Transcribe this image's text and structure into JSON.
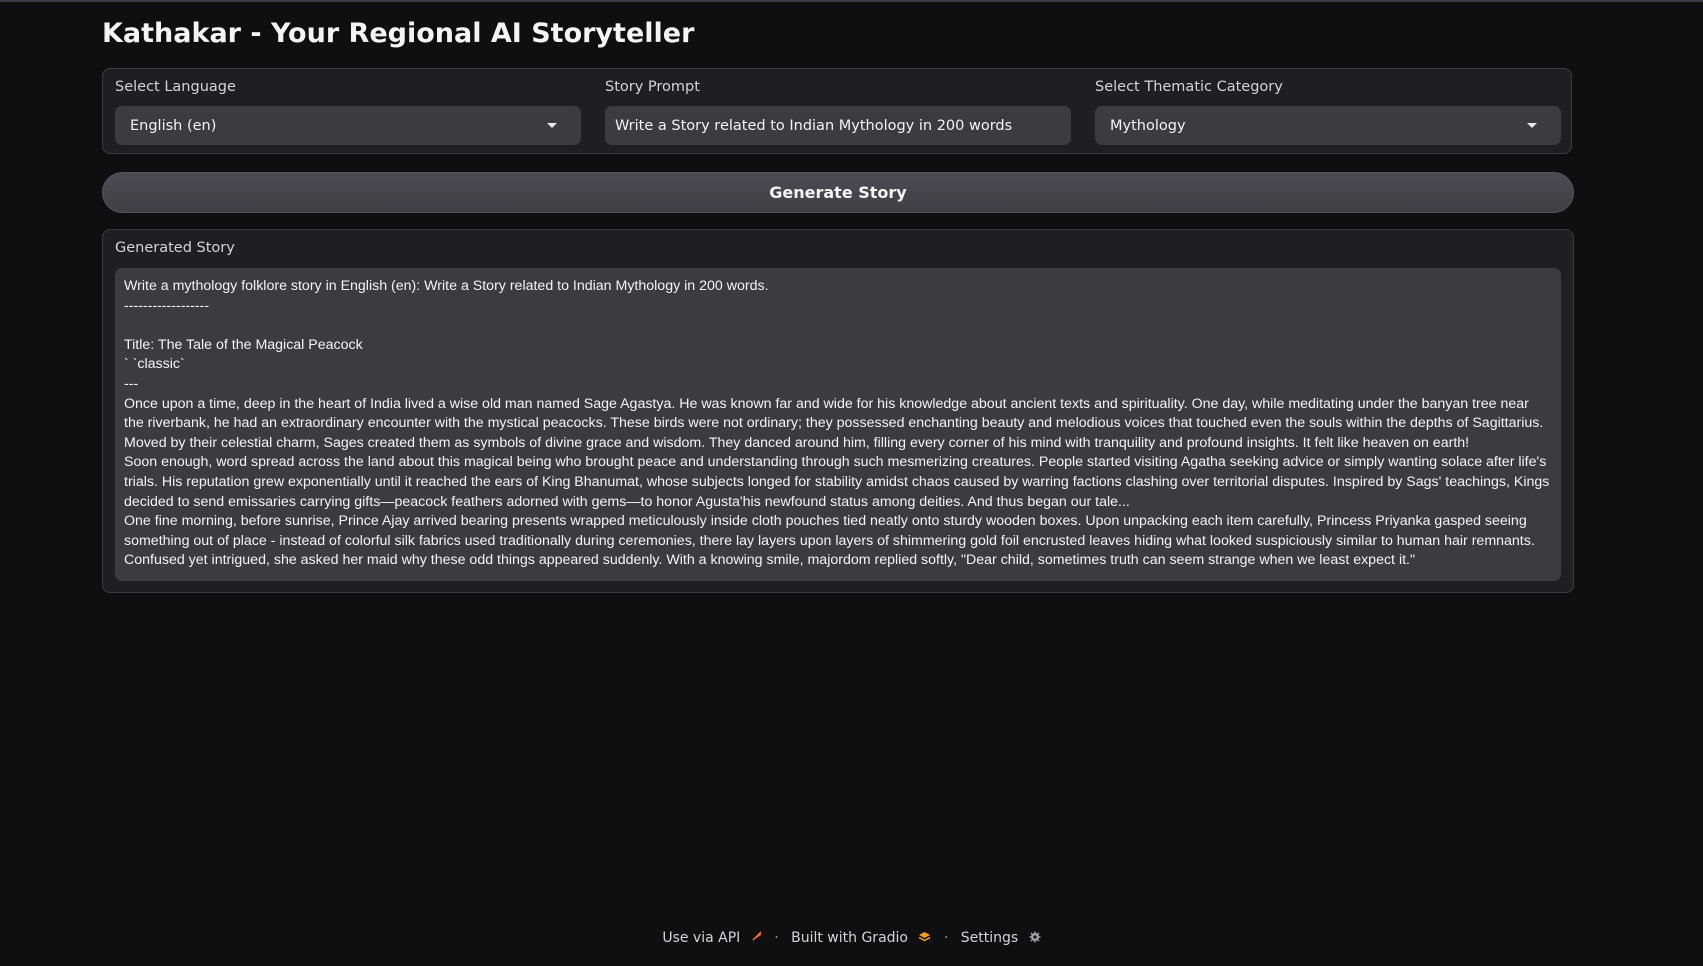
{
  "app": {
    "title": "Kathakar - Your Regional AI Storyteller"
  },
  "inputs": {
    "language": {
      "label": "Select Language",
      "value": "English (en)"
    },
    "prompt": {
      "label": "Story Prompt",
      "value": "Write a Story related to Indian Mythology in 200 words"
    },
    "category": {
      "label": "Select Thematic Category",
      "value": "Mythology"
    }
  },
  "generate_button": {
    "label": "Generate Story"
  },
  "output": {
    "label": "Generated Story",
    "text": "Write a mythology folklore story in English (en): Write a Story related to Indian Mythology in 200 words.\n------------------\n\nTitle: The Tale of the Magical Peacock\n` `classic`\n---\nOnce upon a time, deep in the heart of India lived a wise old man named Sage Agastya. He was known far and wide for his knowledge about ancient texts and spirituality. One day, while meditating under the banyan tree near the riverbank, he had an extraordinary encounter with the mystical peacocks. These birds were not ordinary; they possessed enchanting beauty and melodious voices that touched even the souls within the depths of Sagittarius. Moved by their celestial charm, Sages created them as symbols of divine grace and wisdom. They danced around him, filling every corner of his mind with tranquility and profound insights. It felt like heaven on earth!\nSoon enough, word spread across the land about this magical being who brought peace and understanding through such mesmerizing creatures. People started visiting Agatha seeking advice or simply wanting solace after life's trials. His reputation grew exponentially until it reached the ears of King Bhanumat, whose subjects longed for stability amidst chaos caused by warring factions clashing over territorial disputes. Inspired by Sags' teachings, Kings decided to send emissaries carrying gifts—peacock feathers adorned with gems—to honor Agusta'his newfound status among deities. And thus began our tale...\nOne fine morning, before sunrise, Prince Ajay arrived bearing presents wrapped meticulously inside cloth pouches tied neatly onto sturdy wooden boxes. Upon unpacking each item carefully, Princess Priyanka gasped seeing something out of place - instead of colorful silk fabrics used traditionally during ceremonies, there lay layers upon layers of shimmering gold foil encrusted leaves hiding what looked suspiciously similar to human hair remnants. Confused yet intrigued, she asked her maid why these odd things appeared suddenly. With a knowing smile, majordom replied softly, \"Dear child, sometimes truth can seem strange when we least expect it.\""
  },
  "footer": {
    "api_label": "Use via API",
    "api_icon": "rocket-icon",
    "built_label": "Built with Gradio",
    "built_icon": "gradio-logo-icon",
    "settings_label": "Settings",
    "settings_icon": "gear-icon",
    "separator": "·"
  }
}
